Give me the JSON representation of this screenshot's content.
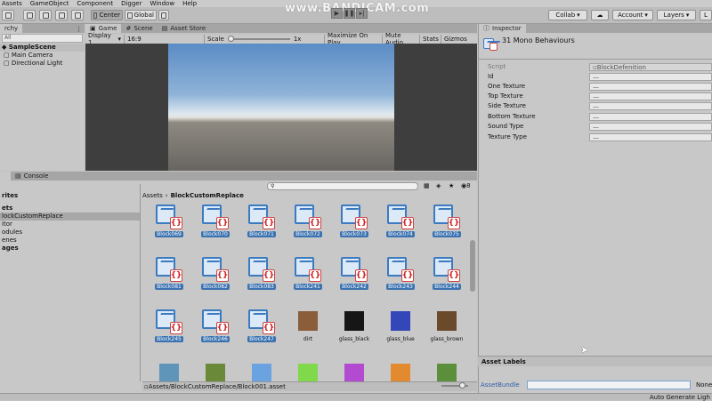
{
  "menu": [
    "Assets",
    "GameObject",
    "Component",
    "Digger",
    "Window",
    "Help"
  ],
  "toolbar": {
    "pivot_label": "Center",
    "space_label": "Global",
    "collab_label": "Collab",
    "account_label": "Account",
    "layers_label": "Layers",
    "layout_label": "L"
  },
  "watermark": "www.BANDICAM.com",
  "hierarchy": {
    "tab_label": "rchy",
    "search_placeholder": "All",
    "scene": "SampleScene",
    "items": [
      "Main Camera",
      "Directional Light"
    ]
  },
  "game_tabs": [
    "Game",
    "Scene",
    "Asset Store"
  ],
  "game_toolbar": {
    "display": "Display 1",
    "aspect": "16:9",
    "scale_label": "Scale",
    "scale_value": "1x",
    "maximize": "Maximize On Play",
    "mute": "Mute Audio",
    "stats": "Stats",
    "gizmos": "Gizmos"
  },
  "inspector": {
    "tab_label": "Inspector",
    "title": "31 Mono Behaviours",
    "rows": [
      {
        "label": "Script",
        "value": "BlockDefenition"
      },
      {
        "label": "Id",
        "value": "—"
      },
      {
        "label": "One Texture",
        "value": "—"
      },
      {
        "label": "Top Texture",
        "value": "—"
      },
      {
        "label": "Side Texture",
        "value": "—"
      },
      {
        "label": "Bottom Texture",
        "value": "—"
      },
      {
        "label": "Sound Type",
        "value": "—"
      },
      {
        "label": "Texture Type",
        "value": "—"
      }
    ],
    "asset_labels": "Asset Labels",
    "asset_bundle_label": "AssetBundle",
    "asset_bundle_value": "None"
  },
  "project": {
    "tabs": [
      "Project",
      "Console"
    ],
    "favorites": "rites",
    "tree": [
      "ets",
      "lockCustomReplace",
      "itor",
      "odules",
      "enes",
      "ages"
    ],
    "breadcrumb_root": "Assets",
    "breadcrumb_sep": "›",
    "breadcrumb_folder": "BlockCustomReplace",
    "asset_count": "8",
    "path": "Assets/BlockCustomReplace/Block001.asset"
  },
  "assets_row1": [
    "Block069",
    "Block070",
    "Block071",
    "Block072",
    "Block073",
    "Block074",
    "Block075"
  ],
  "assets_row2": [
    "Block081",
    "Block082",
    "Block083",
    "Block241",
    "Block242",
    "Block243",
    "Block244"
  ],
  "assets_row3_scripts": [
    "Block245",
    "Block246",
    "Block247"
  ],
  "assets_row3_textures": [
    {
      "name": "dirt",
      "color": "#8a5d3b"
    },
    {
      "name": "glass_black",
      "color": "#161616"
    },
    {
      "name": "glass_blue",
      "color": "#3347b8"
    },
    {
      "name": "glass_brown",
      "color": "#6b4a2c"
    }
  ],
  "assets_row4_colors": [
    "#5e95b8",
    "#6a8a3a",
    "#6aa3e0",
    "#7fd94a",
    "#b24bd0",
    "#e38a30",
    "#5b8f3c"
  ],
  "status": {
    "text": "Auto Generate Ligh"
  }
}
